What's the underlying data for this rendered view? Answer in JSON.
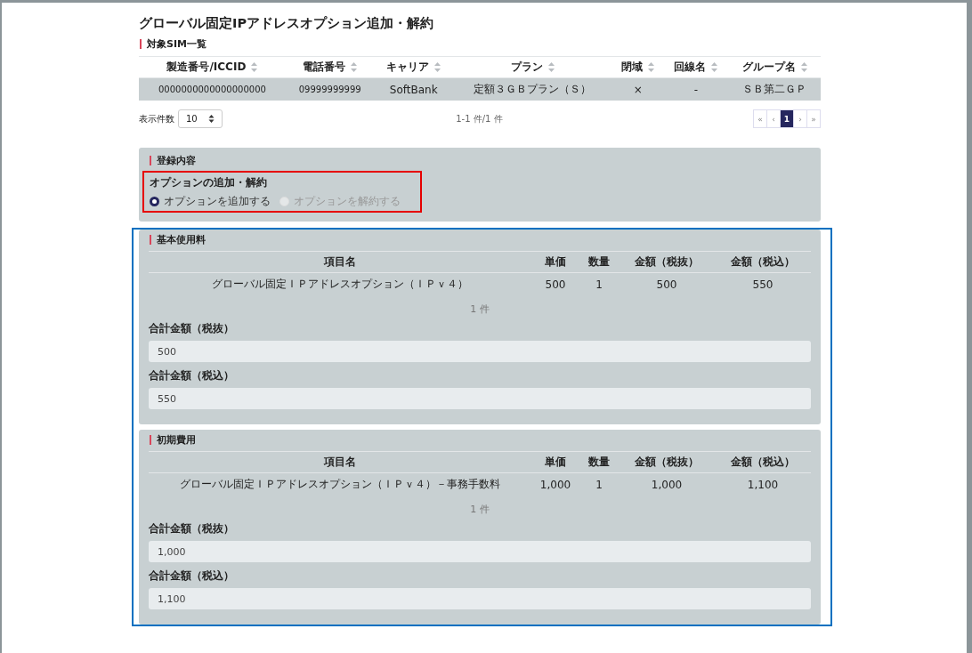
{
  "title": "グローバル固定IPアドレスオプション追加・解約",
  "sim_list": {
    "heading": "対象SIM一覧",
    "columns": [
      {
        "label": "製造番号/ICCID",
        "sortable": true
      },
      {
        "label": "電話番号",
        "sortable": true
      },
      {
        "label": "キャリア",
        "sortable": true
      },
      {
        "label": "プラン",
        "sortable": true
      },
      {
        "label": "閉域",
        "sortable": true
      },
      {
        "label": "回線名",
        "sortable": true
      },
      {
        "label": "グループ名",
        "sortable": true
      }
    ],
    "rows": [
      [
        "0000000000000000000",
        "09999999999",
        "SoftBank",
        "定額３ＧＢプラン（Ｓ）",
        "×",
        "-",
        "ＳＢ第二ＧＰ"
      ]
    ]
  },
  "page_size": {
    "label": "表示件数",
    "value": "10"
  },
  "count_text": "1-1 件/1 件",
  "pagination": [
    {
      "label": "«",
      "selected": false
    },
    {
      "label": "‹",
      "selected": false
    },
    {
      "label": "1",
      "selected": true
    },
    {
      "label": "›",
      "selected": false
    },
    {
      "label": "»",
      "selected": false
    }
  ],
  "registration": {
    "heading": "登録内容",
    "group_label": "オプションの追加・解約",
    "highlighted": true,
    "options": [
      {
        "label": "オプションを追加する",
        "selected": true,
        "disabled": false
      },
      {
        "label": "オプションを解約する",
        "selected": false,
        "disabled": true
      }
    ]
  },
  "fees_highlighted": true,
  "fee_sections": [
    {
      "heading": "基本使用料",
      "columns": [
        "項目名",
        "単価",
        "数量",
        "金額（税抜）",
        "金額（税込）"
      ],
      "rows": [
        [
          "グローバル固定ＩＰアドレスオプション（ＩＰｖ４）",
          "500",
          "1",
          "500",
          "550"
        ]
      ],
      "count": "1 件",
      "totals": [
        {
          "label": "合計金額（税抜）",
          "value": "500"
        },
        {
          "label": "合計金額（税込）",
          "value": "550"
        }
      ]
    },
    {
      "heading": "初期費用",
      "columns": [
        "項目名",
        "単価",
        "数量",
        "金額（税抜）",
        "金額（税込）"
      ],
      "rows": [
        [
          "グローバル固定ＩＰアドレスオプション（ＩＰｖ４）－事務手数料",
          "1,000",
          "1",
          "1,000",
          "1,100"
        ]
      ],
      "count": "1 件",
      "totals": [
        {
          "label": "合計金額（税抜）",
          "value": "1,000"
        },
        {
          "label": "合計金額（税込）",
          "value": "1,100"
        }
      ]
    }
  ]
}
